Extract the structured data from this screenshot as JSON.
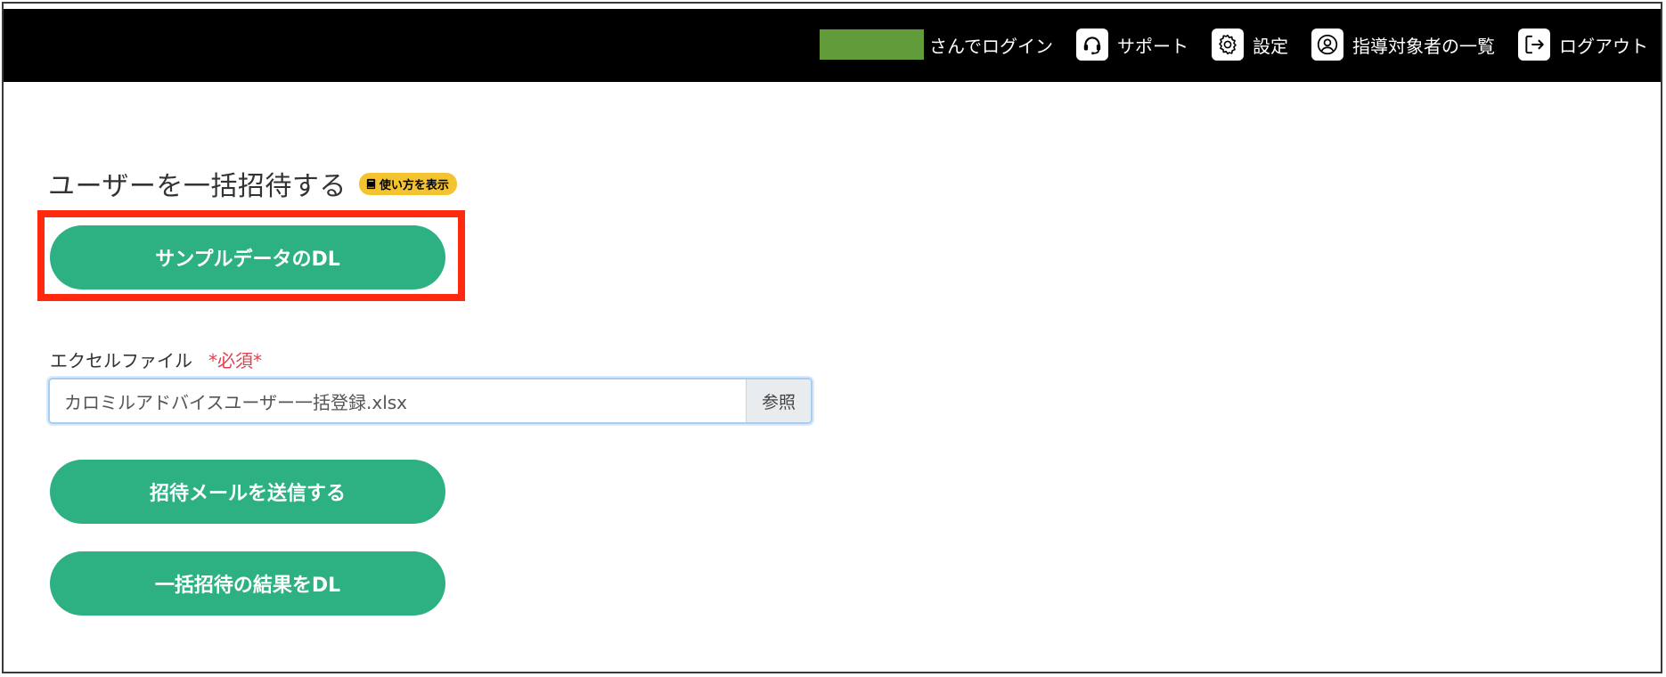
{
  "header": {
    "user_name_block_color": "#629b3a",
    "login_suffix": "さんでログイン",
    "nav": [
      {
        "label": "サポート",
        "icon": "headset-icon"
      },
      {
        "label": "設定",
        "icon": "gear-icon"
      },
      {
        "label": "指導対象者の一覧",
        "icon": "user-circle-icon"
      },
      {
        "label": "ログアウト",
        "icon": "logout-icon"
      }
    ]
  },
  "main": {
    "title": "ユーザーを一括招待する",
    "howto_label": "使い方を表示",
    "sample_button": "サンプルデータのDL",
    "file_label": "エクセルファイル",
    "required_label": "*必須*",
    "file_value": "カロミルアドバイスユーザー一括登録.xlsx",
    "browse_label": "参照",
    "send_button": "招待メールを送信する",
    "result_button": "一括招待の結果をDL"
  },
  "colors": {
    "header_bg": "#000000",
    "primary_button": "#2db182",
    "highlight": "#ff2a0e",
    "badge": "#f4c430",
    "required": "#e0404f"
  }
}
